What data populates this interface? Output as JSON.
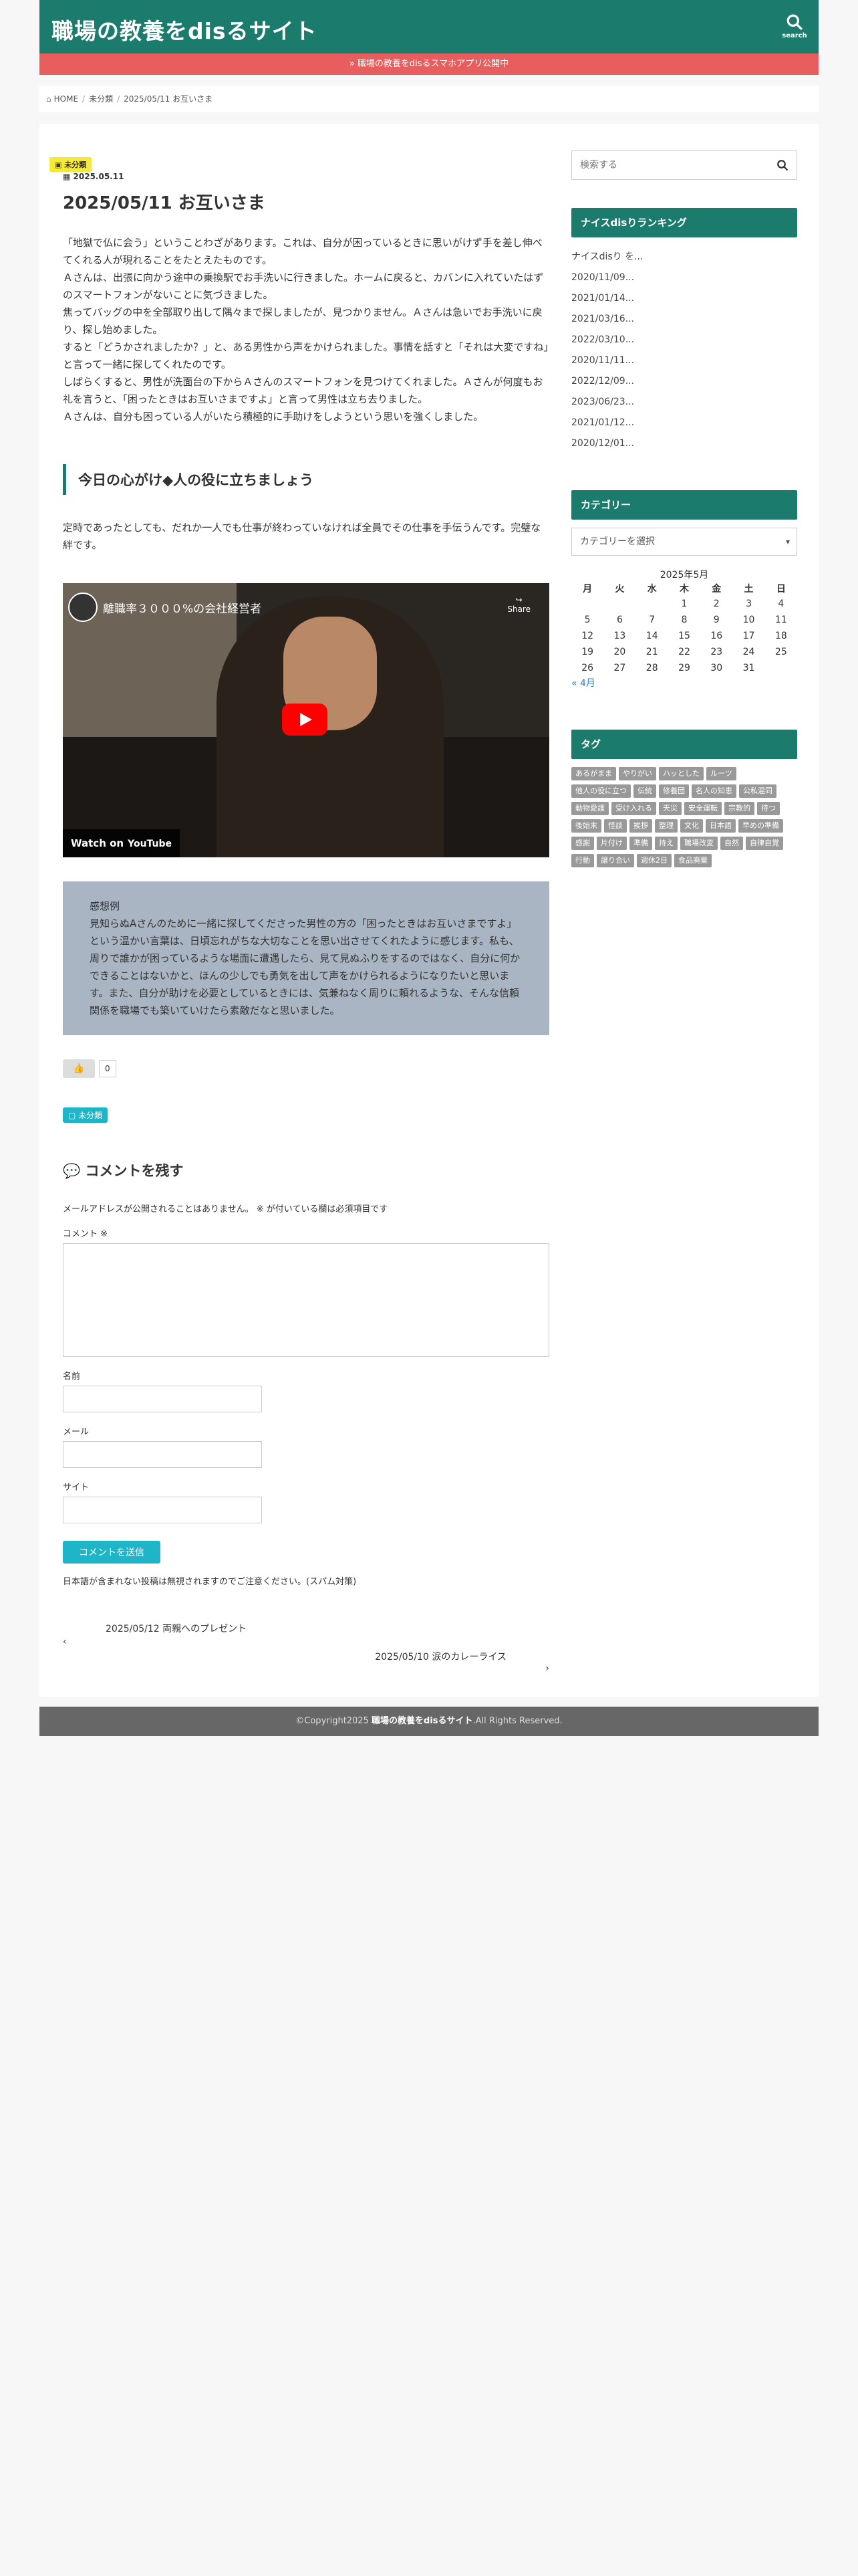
{
  "header": {
    "site_title": "職場の教養をdisるサイト",
    "search_label": "search",
    "notice": "» 職場の教養をdisるスマホアプリ公開中"
  },
  "breadcrumb": [
    "HOME",
    "未分類",
    "2025/05/11 お互いさま"
  ],
  "article": {
    "category_tag": "未分類",
    "date": "2025.05.11",
    "title": "2025/05/11 お互いさま",
    "body": [
      "「地獄で仏に会う」ということわざがあります。これは、自分が困っているときに思いがけず手を差し伸べてくれる人が現れることをたとえたものです。",
      "Ａさんは、出張に向かう途中の乗換駅でお手洗いに行きました。ホームに戻ると、カバンに入れていたはずのスマートフォンがないことに気づきました。",
      "焦ってバッグの中を全部取り出して隅々まで探しましたが、見つかりません。Ａさんは急いでお手洗いに戻り、探し始めました。",
      "すると「どうかされましたか？」と、ある男性から声をかけられました。事情を話すと「それは大変ですね」と言って一緒に探してくれたのです。",
      "しばらくすると、男性が洗面台の下からＡさんのスマートフォンを見つけてくれました。Ａさんが何度もお礼を言うと、「困ったときはお互いさまですよ」と言って男性は立ち去りました。",
      "Ａさんは、自分も困っている人がいたら積極的に手助けをしようという思いを強くしました。"
    ],
    "heading": "今日の心がけ◆人の役に立ちましょう",
    "heading_body": "定時であったとしても、だれか一人でも仕事が終わっていなければ全員でその仕事を手伝うんです。完璧な絆です。",
    "video": {
      "title": "離職率３０００%の会社経営者",
      "share": "Share",
      "watch_on": "Watch on",
      "brand": "YouTube"
    },
    "impression_label": "感想例",
    "impression": "見知らぬAさんのために一緒に探してくださった男性の方の「困ったときはお互いさまですよ」という温かい言葉は、日頃忘れがちな大切なことを思い出させてくれたように感じます。私も、周りで誰かが困っているような場面に遭遇したら、見て見ぬふりをするのではなく、自分に何かできることはないかと、ほんの少しでも勇気を出して声をかけられるようになりたいと思います。また、自分が助けを必要としているときには、気兼ねなく周りに頼れるような、そんな信頼関係を職場でも築いていけたら素敵だなと思いました。",
    "like_count": "0",
    "category_badge": "未分類"
  },
  "comments": {
    "title": "コメントを残す",
    "note": "メールアドレスが公開されることはありません。 ※ が付いている欄は必須項目です",
    "comment_label": "コメント ※",
    "name_label": "名前",
    "email_label": "メール",
    "site_label": "サイト",
    "submit": "コメントを送信",
    "spam_note": "日本語が含まれない投稿は無視されますのでご注意ください。(スパム対策)"
  },
  "post_nav": {
    "prev": "2025/05/12 両親へのプレゼント",
    "next": "2025/05/10 涙のカレーライス"
  },
  "sidebar": {
    "search_placeholder": "検索する",
    "ranking_title": "ナイスdisりランキング",
    "ranking": [
      "ナイスdisり を...",
      "2020/11/09...",
      "2021/01/14...",
      "2021/03/16...",
      "2022/03/10...",
      "2020/11/11...",
      "2022/12/09...",
      "2023/06/23...",
      "2021/01/12...",
      "2020/12/01..."
    ],
    "category_title": "カテゴリー",
    "category_select": "カテゴリーを選択",
    "calendar": {
      "caption": "2025年5月",
      "weekdays": [
        "月",
        "火",
        "水",
        "木",
        "金",
        "土",
        "日"
      ],
      "weeks": [
        [
          "",
          "",
          "",
          "1",
          "2",
          "3",
          "4"
        ],
        [
          "5",
          "6",
          "7",
          "8",
          "9",
          "10",
          "11"
        ],
        [
          "12",
          "13",
          "14",
          "15",
          "16",
          "17",
          "18"
        ],
        [
          "19",
          "20",
          "21",
          "22",
          "23",
          "24",
          "25"
        ],
        [
          "26",
          "27",
          "28",
          "29",
          "30",
          "31",
          ""
        ]
      ],
      "prev": "« 4月"
    },
    "tag_title": "タグ",
    "tags": [
      "あるがまま",
      "やりがい",
      "ハッとした",
      "ルーツ",
      "他人の役に立つ",
      "伝統",
      "修養団",
      "名人の知恵",
      "公私混同",
      "動物愛護",
      "受け入れる",
      "天災",
      "安全運転",
      "宗教的",
      "待つ",
      "後始末",
      "怪談",
      "挨拶",
      "整理",
      "文化",
      "日本語",
      "早めの準備",
      "感謝",
      "片付け",
      "準備",
      "持え",
      "職場改変",
      "自然",
      "自律自覚",
      "行動",
      "譲り合い",
      "週休2日",
      "食品廃棄"
    ]
  },
  "footer": {
    "copyright_prefix": "©Copyright2025 ",
    "site": "職場の教養をdisるサイト",
    "suffix": ".All Rights Reserved."
  }
}
